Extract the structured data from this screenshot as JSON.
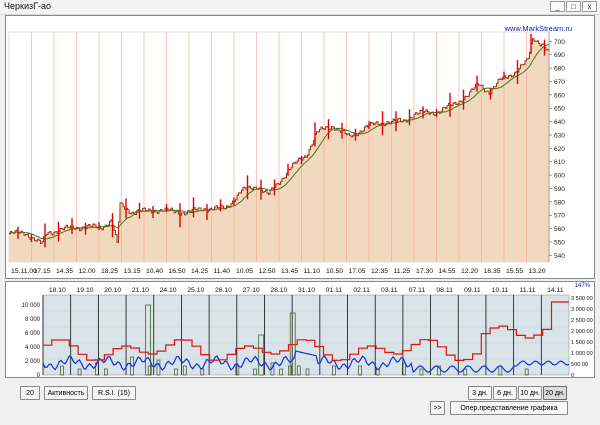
{
  "window": {
    "title": "ЧеркизГ-ао",
    "min": "_",
    "max": "□",
    "close": "x"
  },
  "price_chart": {
    "brand": "www.MarkStream.ru",
    "y_ticks": [
      "700",
      "690",
      "680",
      "670",
      "660",
      "650",
      "640",
      "630",
      "620",
      "610",
      "600",
      "590",
      "580",
      "570",
      "560",
      "550",
      "540"
    ],
    "x_ticks": [
      "15.11.00",
      "17.15",
      "14.35",
      "12.00",
      "18.25",
      "13.15",
      "10.40",
      "16.50",
      "14.25",
      "11.40",
      "10.05",
      "12.50",
      "13.45",
      "11.10",
      "10.50",
      "17.05",
      "12.35",
      "11.25",
      "17.30",
      "14.55",
      "12.20",
      "18.35",
      "15.55",
      "13.20"
    ],
    "y_min": 535,
    "y_max": 707,
    "area_color": "#f1d9bf",
    "line_color": "#a83216",
    "ma_color": "#3a7d1e",
    "spike_color": "#e00000"
  },
  "indicator_chart": {
    "scale_label": "147%",
    "date_ticks": [
      "18.10",
      "19.10",
      "20.10",
      "21.10",
      "24.10",
      "25.10",
      "26.10",
      "27.10",
      "28.10",
      "31.10",
      "01.11",
      "02.11",
      "03.11",
      "07.11",
      "08.11",
      "09.11",
      "10.11",
      "11.11",
      "14.11"
    ],
    "left_ticks": [
      "10 000",
      "8 000",
      "6 000",
      "4 000",
      "2 000",
      "0"
    ],
    "right_ticks": [
      "3 500 00",
      "3 000 00",
      "2 500 00",
      "2 000 00",
      "1 500 00",
      "1 000 00",
      "500 00",
      "0"
    ],
    "blue_color": "#1030e0",
    "red_color": "#e01010",
    "bg_color": "#d9e4e9"
  },
  "controls": {
    "period_value": "20",
    "activity_label": "Активность",
    "rsi_label": "R.S.I.  (15)",
    "range_buttons": [
      "3 дн.",
      "6 дн.",
      "10 дн.",
      "20 дн."
    ],
    "active_range": "20 дн.",
    "scroll_label": ">>",
    "view_label": "Опер.представление графика"
  }
}
